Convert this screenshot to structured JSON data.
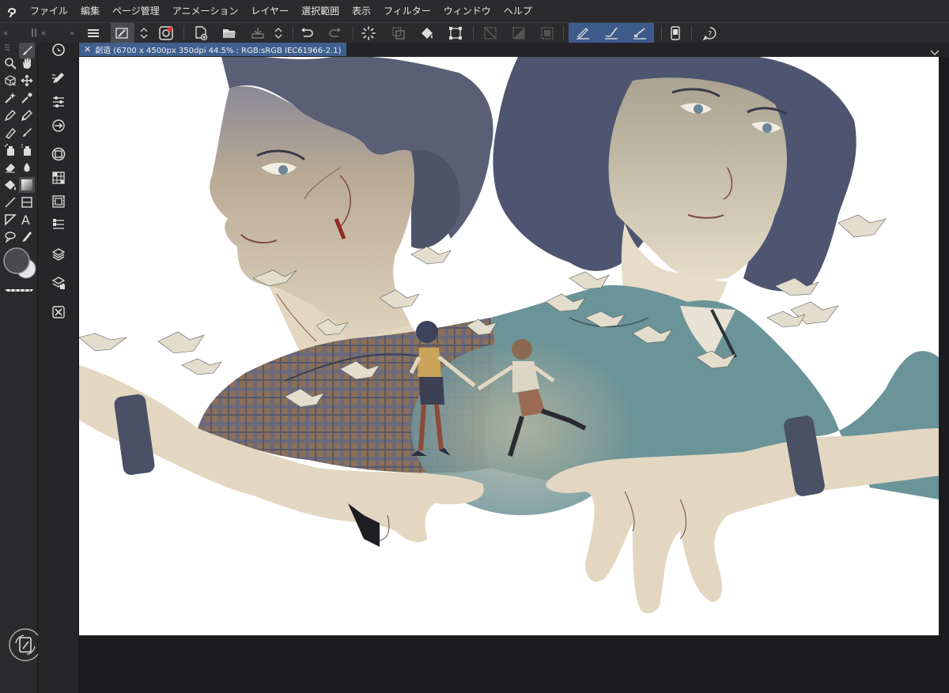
{
  "menubar": {
    "items": [
      "ファイル",
      "編集",
      "ページ管理",
      "アニメーション",
      "レイヤー",
      "選択範囲",
      "表示",
      "フィルター",
      "ウィンドウ",
      "ヘルプ"
    ]
  },
  "document": {
    "tab_label": "創造 (6700 x 4500px 350dpi 44.5% : RGB:sRGB IEC61966-2.1)"
  },
  "colors": {
    "accent": "#3d5a8a",
    "menubar_bg": "#2b2b2d",
    "palette_bg": "#2a2a2c",
    "main_color": "#4a4a4e",
    "sub_color": "#e8e4ec"
  },
  "icons": {
    "app": "clip-studio-icon",
    "command_bar": [
      "menu-icon",
      "auto-action-icon",
      "up-down-icon",
      "clip-studio-icon",
      "new-file-icon",
      "open-folder-icon",
      "save-icon",
      "up-down-icon",
      "undo-icon",
      "redo-icon",
      "loading-icon",
      "copy-icon",
      "fill-bucket-icon",
      "transform-icon",
      "deselect-icon",
      "select-all-icon",
      "invert-selection-icon",
      "pen-stabilizer-icon",
      "brush-stroke-icon",
      "line-icon",
      "smartphone-icon",
      "help-icon"
    ],
    "tools": [
      "brush-icon",
      "zoom-icon",
      "hand-icon",
      "operation-icon",
      "move-icon",
      "magic-wand-icon",
      "eyedropper-icon",
      "pen-icon",
      "pencil-icon",
      "brush-icon",
      "marker-icon",
      "airbrush-icon",
      "decoration-icon",
      "eraser-icon",
      "blend-icon",
      "fill-icon",
      "gradient-icon",
      "line-icon",
      "frame-icon",
      "ruler-icon",
      "text-icon",
      "balloon-icon",
      "correction-icon"
    ]
  }
}
